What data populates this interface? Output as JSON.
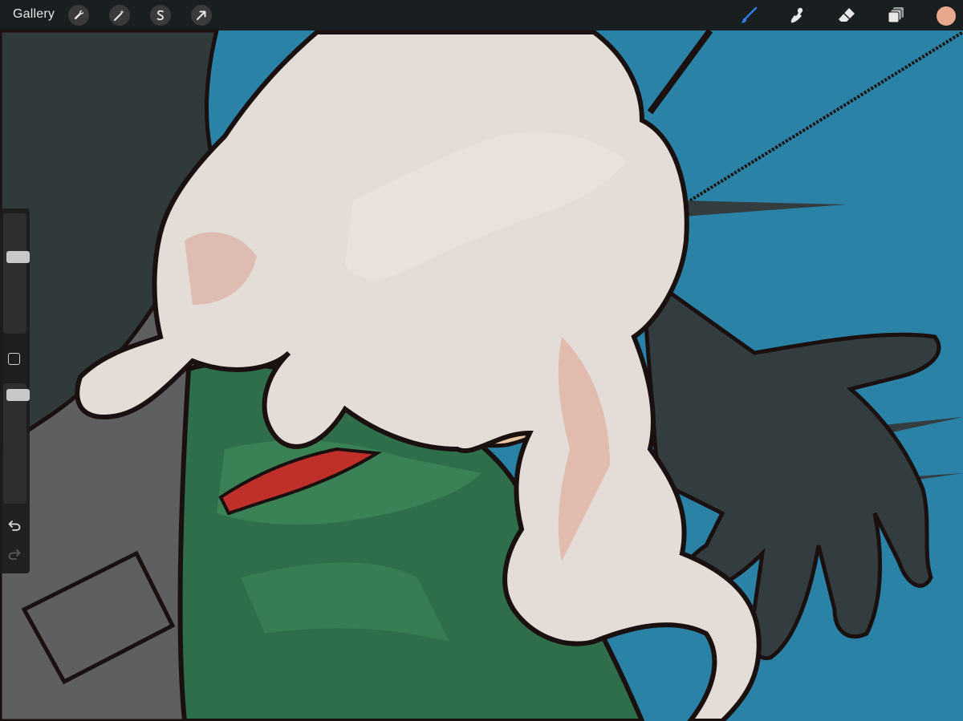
{
  "toolbar": {
    "gallery_label": "Gallery",
    "left_tools": [
      {
        "name": "actions",
        "icon": "wrench-icon"
      },
      {
        "name": "adjustments",
        "icon": "magic-wand-icon"
      },
      {
        "name": "selection",
        "icon": "selection-s-icon"
      },
      {
        "name": "transform",
        "icon": "arrow-cursor-icon"
      }
    ],
    "right_tools": [
      {
        "name": "brush",
        "icon": "brush-icon",
        "active": true
      },
      {
        "name": "smudge",
        "icon": "smudge-icon"
      },
      {
        "name": "eraser",
        "icon": "eraser-icon"
      },
      {
        "name": "layers",
        "icon": "layers-icon"
      }
    ],
    "current_color": "#e8a88c",
    "active_tool_color": "#2f7fe6"
  },
  "sidebar": {
    "brush_size_level": 0.65,
    "opacity_level": 0.95,
    "modify_icon": "square-icon",
    "undo_icon": "undo-icon",
    "redo_icon": "redo-icon"
  },
  "canvas": {
    "colors": {
      "background_blue": "#2a82a6",
      "hair": "#e4dcd6",
      "skin": "#ecc6a0",
      "jacket": "#2f6e4a",
      "collar": "#c0302a",
      "shadow_figure": "#333c3e",
      "ink": "#1a1010"
    }
  }
}
